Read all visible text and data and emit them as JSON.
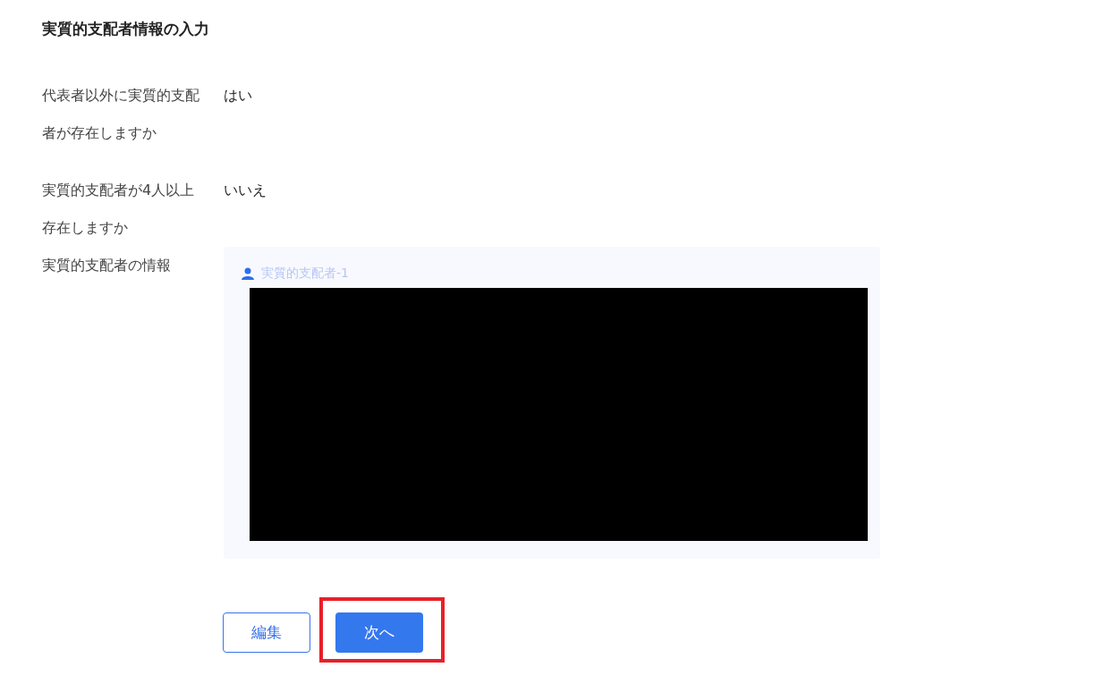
{
  "title": "実質的支配者情報の入力",
  "fields": [
    {
      "label": "代表者以外に実質的支配者が存在しますか",
      "value": "はい"
    },
    {
      "label": "実質的支配者が4人以上存在しますか",
      "value": "いいえ"
    }
  ],
  "owners_section": {
    "label": "実質的支配者の情報",
    "panels": [
      {
        "title": "実質的支配者-1",
        "redacted": true
      }
    ]
  },
  "buttons": [
    {
      "label": "編集",
      "kind": "outline",
      "highlighted": false
    },
    {
      "label": "次へ",
      "kind": "primary",
      "highlighted": true
    }
  ]
}
